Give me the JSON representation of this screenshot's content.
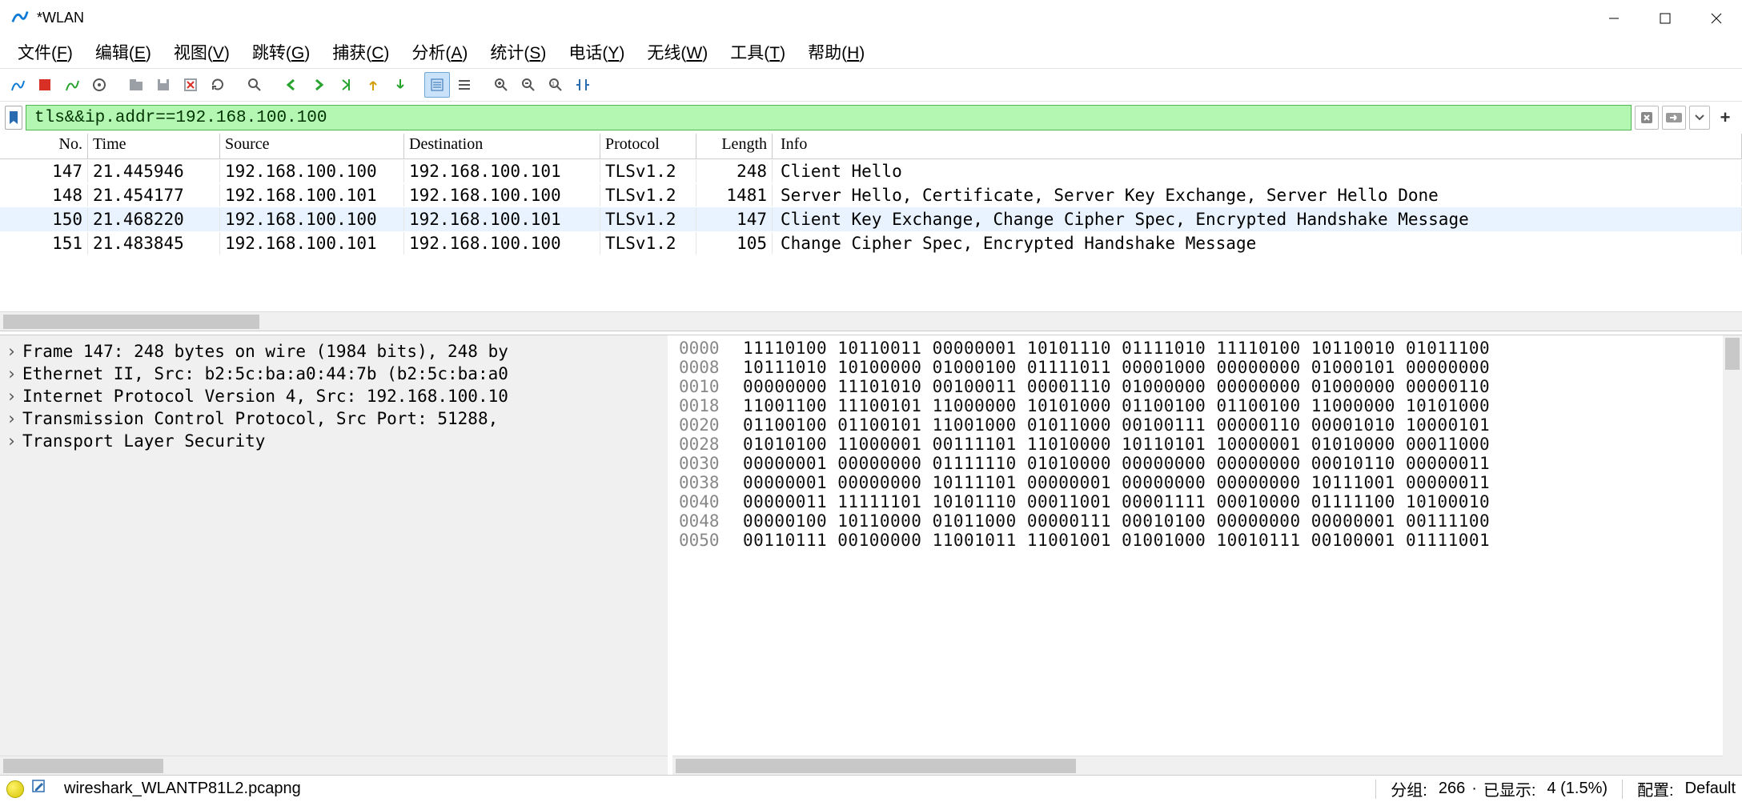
{
  "title": "*WLAN",
  "menus": [
    {
      "label": "文件(",
      "u": "F",
      "tail": ")"
    },
    {
      "label": "编辑(",
      "u": "E",
      "tail": ")"
    },
    {
      "label": "视图(",
      "u": "V",
      "tail": ")"
    },
    {
      "label": "跳转(",
      "u": "G",
      "tail": ")"
    },
    {
      "label": "捕获(",
      "u": "C",
      "tail": ")"
    },
    {
      "label": "分析(",
      "u": "A",
      "tail": ")"
    },
    {
      "label": "统计(",
      "u": "S",
      "tail": ")"
    },
    {
      "label": "电话(",
      "u": "Y",
      "tail": ")"
    },
    {
      "label": "无线(",
      "u": "W",
      "tail": ")"
    },
    {
      "label": "工具(",
      "u": "T",
      "tail": ")"
    },
    {
      "label": "帮助(",
      "u": "H",
      "tail": ")"
    }
  ],
  "filter_value": "tls&&ip.addr==192.168.100.100",
  "columns": {
    "no": "No.",
    "time": "Time",
    "src": "Source",
    "dst": "Destination",
    "proto": "Protocol",
    "len": "Length",
    "info": "Info"
  },
  "packets": [
    {
      "no": "147",
      "time": "21.445946",
      "src": "192.168.100.100",
      "dst": "192.168.100.101",
      "proto": "TLSv1.2",
      "len": "248",
      "info": "Client Hello",
      "sel": false
    },
    {
      "no": "148",
      "time": "21.454177",
      "src": "192.168.100.101",
      "dst": "192.168.100.100",
      "proto": "TLSv1.2",
      "len": "1481",
      "info": "Server Hello, Certificate, Server Key Exchange, Server Hello Done",
      "sel": false
    },
    {
      "no": "150",
      "time": "21.468220",
      "src": "192.168.100.100",
      "dst": "192.168.100.101",
      "proto": "TLSv1.2",
      "len": "147",
      "info": "Client Key Exchange, Change Cipher Spec, Encrypted Handshake Message",
      "sel": true
    },
    {
      "no": "151",
      "time": "21.483845",
      "src": "192.168.100.101",
      "dst": "192.168.100.100",
      "proto": "TLSv1.2",
      "len": "105",
      "info": "Change Cipher Spec, Encrypted Handshake Message",
      "sel": false
    }
  ],
  "details": [
    "Frame 147: 248 bytes on wire (1984 bits), 248 by",
    "Ethernet II, Src: b2:5c:ba:a0:44:7b (b2:5c:ba:a0",
    "Internet Protocol Version 4, Src: 192.168.100.10",
    "Transmission Control Protocol, Src Port: 51288,",
    "Transport Layer Security"
  ],
  "bytes": [
    {
      "off": "0000",
      "bits": "11110100 10110011 00000001 10101110 01111010 11110100 10110010 01011100"
    },
    {
      "off": "0008",
      "bits": "10111010 10100000 01000100 01111011 00001000 00000000 01000101 00000000"
    },
    {
      "off": "0010",
      "bits": "00000000 11101010 00100011 00001110 01000000 00000000 01000000 00000110"
    },
    {
      "off": "0018",
      "bits": "11001100 11100101 11000000 10101000 01100100 01100100 11000000 10101000"
    },
    {
      "off": "0020",
      "bits": "01100100 01100101 11001000 01011000 00100111 00000110 00001010 10000101"
    },
    {
      "off": "0028",
      "bits": "01010100 11000001 00111101 11010000 10110101 10000001 01010000 00011000"
    },
    {
      "off": "0030",
      "bits": "00000001 00000000 01111110 01010000 00000000 00000000 00010110 00000011"
    },
    {
      "off": "0038",
      "bits": "00000001 00000000 10111101 00000001 00000000 00000000 10111001 00000011"
    },
    {
      "off": "0040",
      "bits": "00000011 11111101 10101110 00011001 00001111 00010000 01111100 10100010"
    },
    {
      "off": "0048",
      "bits": "00000100 10110000 01011000 00000111 00010100 00000000 00000001 00111100"
    },
    {
      "off": "0050",
      "bits": "00110111 00100000 11001011 11001001 01001000 10010111 00100001 01111001"
    }
  ],
  "status": {
    "filename": "wireshark_WLANTP81L2.pcapng",
    "groups_label": "分组:",
    "groups_val": "266",
    "dot": " · ",
    "displayed_label": "已显示:",
    "displayed_val": "4 (1.5%)",
    "profile_label": "配置:",
    "profile_val": "Default"
  }
}
